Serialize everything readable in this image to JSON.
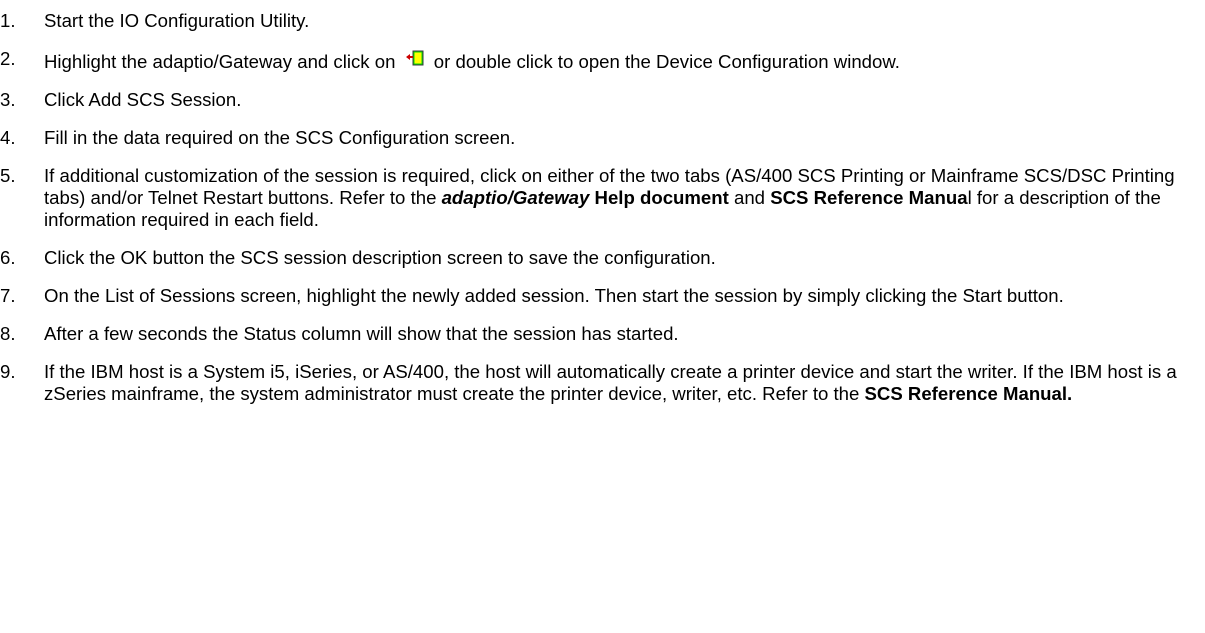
{
  "steps": [
    {
      "num": "1.",
      "text": "Start the IO Configuration Utility."
    },
    {
      "num": "2.",
      "before_icon": "Highlight the adaptio/Gateway and click on",
      "icon": "open-device-config-icon",
      "after_icon": "or double click to open the Device Configuration window."
    },
    {
      "num": "3.",
      "text": "Click Add SCS Session."
    },
    {
      "num": "4.",
      "text": "Fill in the data required on the SCS Configuration screen."
    },
    {
      "num": "5.",
      "part1": "If additional customization of the session is required, click on either of the two tabs (AS/400 SCS Printing or Mainframe SCS/DSC Printing tabs) and/or Telnet Restart buttons.  Refer to the",
      "bold_italic": "adaptio/Gateway",
      "bold1": "Help document",
      "part2": "and",
      "bold2": "SCS Reference Manua",
      "part3": "l for a description of the information required in each field."
    },
    {
      "num": "6.",
      "text": "Click the OK button the SCS session description screen to save the configuration."
    },
    {
      "num": "7.",
      "text": "On the List of Sessions screen, highlight the newly added session.  Then start the session by simply clicking the Start button."
    },
    {
      "num": "8.",
      "text": "After a few seconds the Status column will show that the session has started."
    },
    {
      "num": "9.",
      "part1": "If the IBM host is a System i5, iSeries, or AS/400, the host will automatically create a printer device and start the writer.  If the IBM host is a zSeries mainframe, the system administrator must create the printer device, writer, etc.  Refer to the",
      "bold1": "SCS Reference Manual."
    }
  ]
}
